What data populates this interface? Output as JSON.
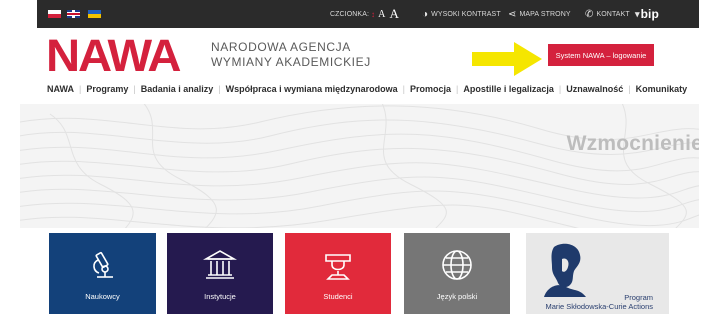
{
  "topbar": {
    "flags": [
      "pl-flag-icon",
      "uk-flag-icon",
      "ua-flag-icon"
    ],
    "font_label": "CZCIONKA:",
    "font_small": "A",
    "font_large": "A",
    "contrast_label": "WYSOKI KONTRAST",
    "sitemap_label": "MAPA STRONY",
    "contact_label": "KONTAKT",
    "bip_label": "bip"
  },
  "header": {
    "logo": "NAWA",
    "agency_line1": "NARODOWA AGENCJA",
    "agency_line2": "WYMIANY AKADEMICKIEJ",
    "login_button": "System NAWA – logowanie"
  },
  "nav": {
    "items": [
      "NAWA",
      "Programy",
      "Badania i analizy",
      "Współpraca i wymiana międzynarodowa",
      "Promocja",
      "Apostille i legalizacja",
      "Uznawalność",
      "Komunikaty"
    ]
  },
  "hero": {
    "text": "Wzmocnienie"
  },
  "tiles": [
    {
      "label": "Naukowcy",
      "icon": "microscope-icon",
      "color": "#13417a"
    },
    {
      "label": "Instytucje",
      "icon": "building-icon",
      "color": "#251a4f"
    },
    {
      "label": "Studenci",
      "icon": "graduate-icon",
      "color": "#e12a3b"
    },
    {
      "label": "Język polski",
      "icon": "globe-icon",
      "color": "#767676"
    },
    {
      "label_line1": "Program",
      "label_line2": "Marie Skłodowska-Curie Actions",
      "icon": "marie-curie-portrait-icon",
      "color": "#e8e8e8"
    }
  ],
  "colors": {
    "brand_red": "#d4213d",
    "topbar": "#2b2b2b",
    "arrow": "#f5e600"
  }
}
